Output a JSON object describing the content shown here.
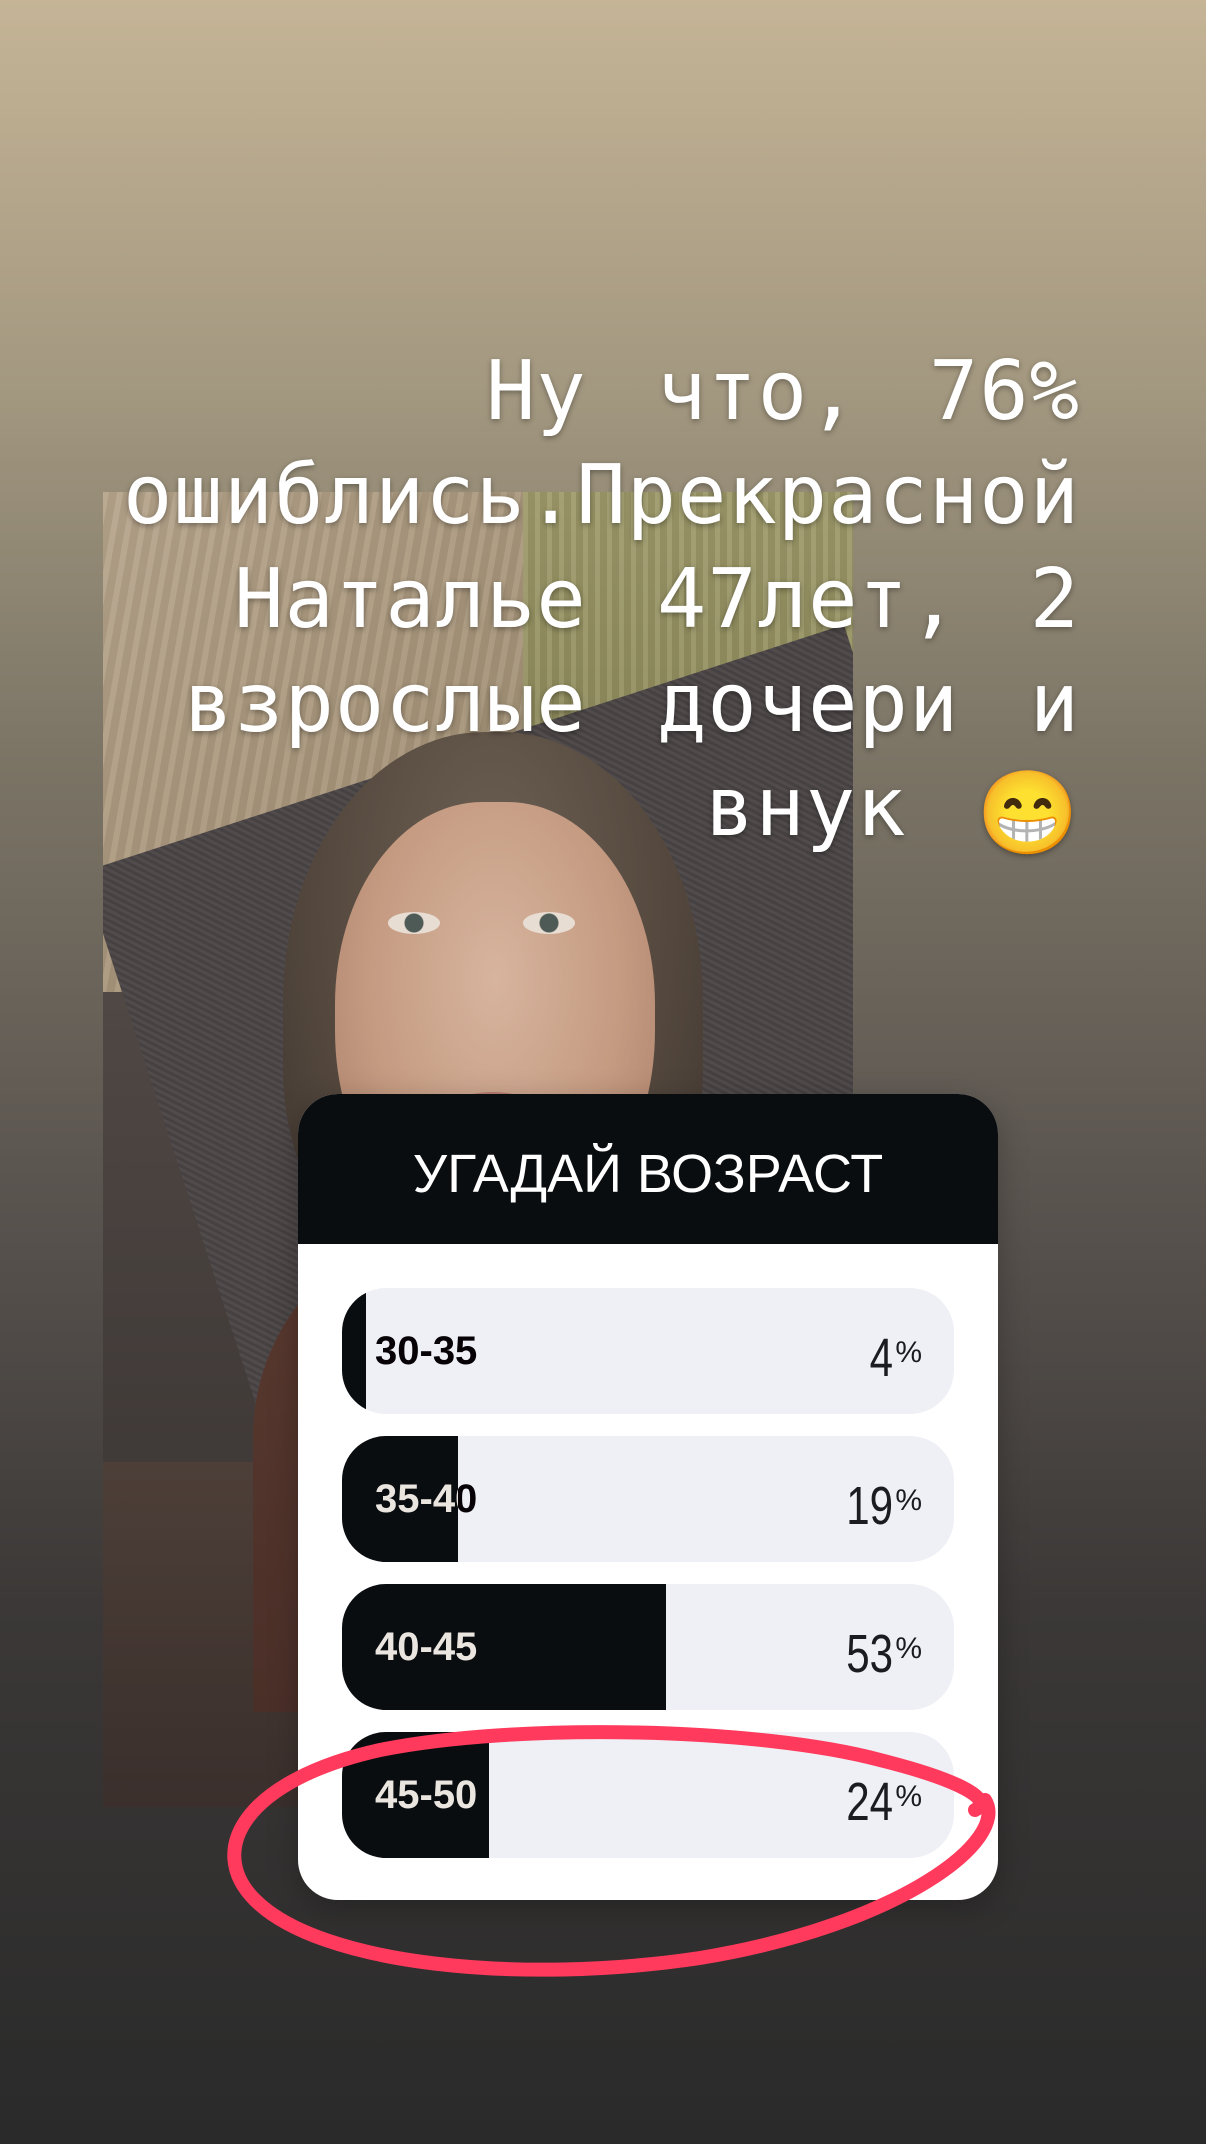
{
  "story": {
    "caption_lines": [
      "Ну что, 76%",
      "ошиблись.Прекрасной",
      "Наталье 47лет, 2",
      "взрослые дочери и",
      "внук"
    ],
    "caption_emoji": "😁"
  },
  "poll": {
    "title": "УГАДАЙ ВОЗРАСТ",
    "options": [
      {
        "label": "30-35",
        "percent": "4",
        "fill": 0.04
      },
      {
        "label": "35-40",
        "percent": "19",
        "fill": 0.19
      },
      {
        "label": "40-45",
        "percent": "53",
        "fill": 0.53
      },
      {
        "label": "45-50",
        "percent": "24",
        "fill": 0.24
      }
    ],
    "percent_sign": "%"
  },
  "annotation": {
    "circle_color": "#ff3a5c",
    "circled_option": "45-50"
  }
}
